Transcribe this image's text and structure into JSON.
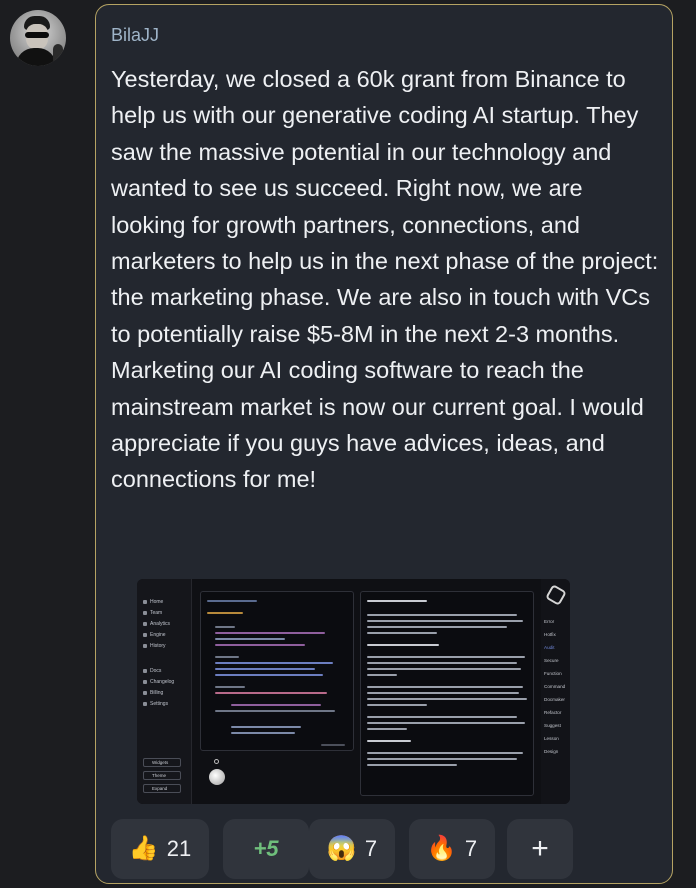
{
  "post": {
    "author": "BilaJJ",
    "message": "Yesterday, we closed a 60k grant from Binance to help us with our generative coding AI startup. They saw the massive potential in our technology and wanted to see us succeed. Right now, we are looking for growth partners, connections, and marketers to help us in the next phase of the project: the marketing phase. We are also in touch with VCs to potentially raise $5-8M in the next 2-3 months. Marketing our AI coding software to reach the mainstream market is now our current goal. I would appreciate if you guys have advices, ideas, and connections for me!"
  },
  "screenshot": {
    "sidebar": [
      "Home",
      "Team",
      "Analytics",
      "Engine",
      "History",
      "Docs",
      "Changelog",
      "Billing",
      "Settings"
    ],
    "buttons": [
      "Widgets",
      "Theme",
      "Expand"
    ],
    "right_labels": [
      "Error",
      "Hotfix",
      "Audit",
      "Secure",
      "Function",
      "Command",
      "Docmaker",
      "Refactor",
      "Suggest",
      "Lesson",
      "Design"
    ]
  },
  "reactions": [
    {
      "icon": "thumbs-up-icon",
      "emoji": "👍",
      "count": "21"
    },
    {
      "label": "+5"
    },
    {
      "icon": "scream-icon",
      "emoji": "😱",
      "count": "7"
    },
    {
      "icon": "fire-icon",
      "emoji": "🔥",
      "count": "7"
    },
    {
      "label": "+"
    }
  ],
  "colors": {
    "bubble_border": "#b5a363",
    "bubble_bg": "#23272f",
    "author": "#9fb4c8",
    "reaction_bg": "#30343c",
    "plus_reaction": "#6fbf7c"
  }
}
